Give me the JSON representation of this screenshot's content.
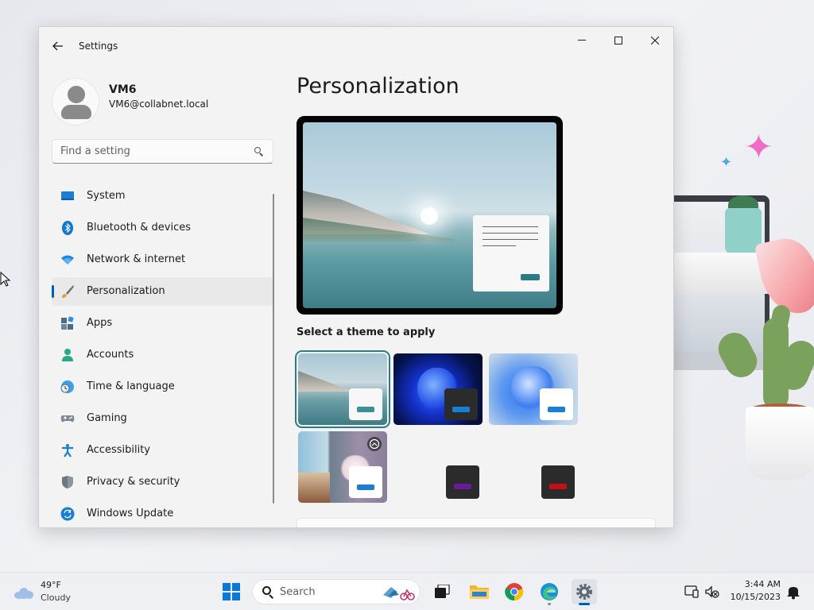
{
  "window": {
    "title": "Settings"
  },
  "profile": {
    "name": "VM6",
    "email": "VM6@collabnet.local"
  },
  "search": {
    "placeholder": "Find a setting"
  },
  "nav": {
    "items": [
      {
        "label": "System",
        "icon": "system-icon",
        "selected": false
      },
      {
        "label": "Bluetooth & devices",
        "icon": "bluetooth-icon",
        "selected": false
      },
      {
        "label": "Network & internet",
        "icon": "wifi-icon",
        "selected": false
      },
      {
        "label": "Personalization",
        "icon": "brush-icon",
        "selected": true
      },
      {
        "label": "Apps",
        "icon": "apps-icon",
        "selected": false
      },
      {
        "label": "Accounts",
        "icon": "accounts-icon",
        "selected": false
      },
      {
        "label": "Time & language",
        "icon": "time-language-icon",
        "selected": false
      },
      {
        "label": "Gaming",
        "icon": "gamepad-icon",
        "selected": false
      },
      {
        "label": "Accessibility",
        "icon": "accessibility-icon",
        "selected": false
      },
      {
        "label": "Privacy & security",
        "icon": "shield-icon",
        "selected": false
      },
      {
        "label": "Windows Update",
        "icon": "update-icon",
        "selected": false
      }
    ]
  },
  "main": {
    "title": "Personalization",
    "theme_heading": "Select a theme to apply",
    "themes": [
      {
        "name": "windows-spotlight-lake",
        "selected": true
      },
      {
        "name": "windows-dark-bloom",
        "selected": false
      },
      {
        "name": "windows-light-bloom",
        "selected": false
      },
      {
        "name": "flowers-photo",
        "selected": false
      },
      {
        "name": "dark-purple",
        "selected": false
      },
      {
        "name": "dark-red",
        "selected": false
      }
    ]
  },
  "taskbar": {
    "weather_temp": "49°F",
    "weather_desc": "Cloudy",
    "search_label": "Search",
    "time": "3:44 AM",
    "date": "10/15/2023"
  },
  "colors": {
    "accent": "#005fb8",
    "theme_accent": "#2a7b84"
  }
}
